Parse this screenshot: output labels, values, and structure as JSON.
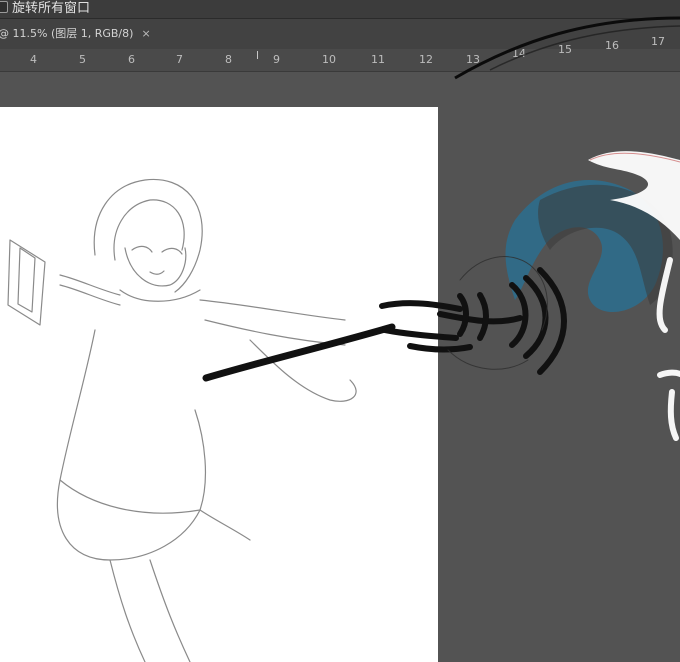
{
  "options_bar": {
    "rotate_all_windows_label": "旋转所有窗口",
    "rotate_all_windows_checked": false
  },
  "document_tab": {
    "title": "@ 11.5% (图层 1, RGB/8)",
    "close_glyph": "×"
  },
  "ruler": {
    "labels": [
      "4",
      "5",
      "6",
      "7",
      "8",
      "9",
      "10",
      "11",
      "12",
      "13",
      "14",
      "15",
      "16",
      "17"
    ]
  },
  "colors": {
    "workspace_bg": "#535353",
    "canvas_bg": "#ffffff",
    "ui_dark": "#3c3c3c",
    "sketch_line": "#8a8a8a",
    "brush_black": "#111111",
    "smudge_blue": "#2c6f8f"
  },
  "icons": {
    "checkbox": "checkbox-icon",
    "close": "close-icon"
  }
}
